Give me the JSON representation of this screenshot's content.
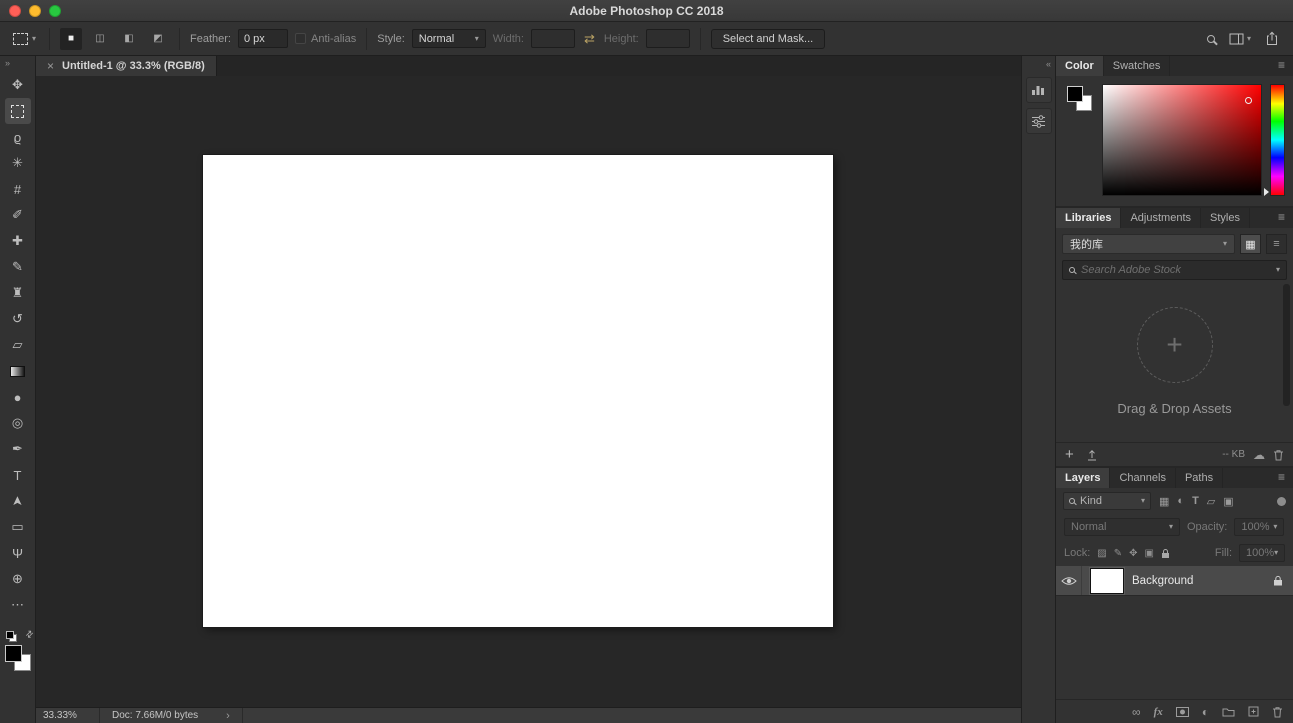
{
  "window": {
    "title": "Adobe Photoshop CC 2018"
  },
  "options_bar": {
    "mode_buttons": [
      {
        "name": "new-selection",
        "glyph": "■"
      },
      {
        "name": "add-to-selection",
        "glyph": "◫"
      },
      {
        "name": "subtract-from-selection",
        "glyph": "◧"
      },
      {
        "name": "intersect-with-selection",
        "glyph": "◩"
      }
    ],
    "feather_label": "Feather:",
    "feather_value": "0 px",
    "antialias_label": "Anti-alias",
    "style_label": "Style:",
    "style_value": "Normal",
    "width_label": "Width:",
    "width_value": "",
    "height_label": "Height:",
    "height_value": "",
    "select_and_mask_label": "Select and Mask..."
  },
  "document_tab": {
    "title": "Untitled-1 @ 33.3% (RGB/8)"
  },
  "toolbar": {
    "selected_tool": "rectangular-marquee-tool",
    "tools": [
      {
        "name": "move-tool",
        "glyph": "✥"
      },
      {
        "name": "rectangular-marquee-tool",
        "glyph": ""
      },
      {
        "name": "lasso-tool",
        "glyph": "ϱ"
      },
      {
        "name": "quick-selection-tool",
        "glyph": "✳"
      },
      {
        "name": "crop-tool",
        "glyph": "#"
      },
      {
        "name": "eyedropper-tool",
        "glyph": "✐"
      },
      {
        "name": "spot-healing-brush-tool",
        "glyph": "✚"
      },
      {
        "name": "brush-tool",
        "glyph": "✎"
      },
      {
        "name": "clone-stamp-tool",
        "glyph": "♜"
      },
      {
        "name": "history-brush-tool",
        "glyph": "↺"
      },
      {
        "name": "eraser-tool",
        "glyph": "▱"
      },
      {
        "name": "gradient-tool",
        "glyph": ""
      },
      {
        "name": "blur-tool",
        "glyph": "●"
      },
      {
        "name": "dodge-tool",
        "glyph": "◎"
      },
      {
        "name": "pen-tool",
        "glyph": "✒"
      },
      {
        "name": "horizontal-type-tool",
        "glyph": "T"
      },
      {
        "name": "path-selection-tool",
        "glyph": "➤"
      },
      {
        "name": "rectangle-tool",
        "glyph": "▭"
      },
      {
        "name": "hand-tool",
        "glyph": "Ψ"
      },
      {
        "name": "zoom-tool",
        "glyph": "⊕"
      },
      {
        "name": "edit-toolbar-button",
        "glyph": "⋯"
      }
    ]
  },
  "statusbar": {
    "zoom": "33.33%",
    "doc_info": "Doc: 7.66M/0 bytes"
  },
  "color_panel": {
    "tabs": [
      "Color",
      "Swatches"
    ],
    "active_tab": "Color"
  },
  "libraries_panel": {
    "tabs": [
      "Libraries",
      "Adjustments",
      "Styles"
    ],
    "active_tab": "Libraries",
    "library_name": "我的库",
    "search_placeholder": "Search Adobe Stock",
    "dropzone_label": "Drag & Drop Assets",
    "size_label": "-- KB"
  },
  "layers_panel": {
    "tabs": [
      "Layers",
      "Channels",
      "Paths"
    ],
    "active_tab": "Layers",
    "filter_label": "Kind",
    "filter_icons": [
      {
        "name": "filter-pixel-layers",
        "glyph": "▦"
      },
      {
        "name": "filter-adjustment-layers",
        "glyph": "◐"
      },
      {
        "name": "filter-type-layers",
        "glyph": "T"
      },
      {
        "name": "filter-shape-layers",
        "glyph": "▱"
      },
      {
        "name": "filter-smart-objects",
        "glyph": "▣"
      }
    ],
    "blend_mode": "Normal",
    "opacity_label": "Opacity:",
    "opacity_value": "100%",
    "lock_label": "Lock:",
    "lock_icons": [
      {
        "name": "lock-transparent-pixels",
        "glyph": "▨"
      },
      {
        "name": "lock-image-pixels",
        "glyph": "✎"
      },
      {
        "name": "lock-position",
        "glyph": "✥"
      },
      {
        "name": "lock-artboards",
        "glyph": "▣"
      }
    ],
    "fill_label": "Fill:",
    "fill_value": "100%",
    "layers": [
      {
        "name": "Background",
        "visible": true,
        "locked": true
      }
    ],
    "fx_icon_label": "fx"
  },
  "icons": {
    "panel_menu": "≡",
    "chevron_down": "▾",
    "chevron_right": "›",
    "collapse_dock": "«",
    "expand_toolbar": "»",
    "swap_dimensions": "⇄",
    "swap_colors": "⇄",
    "grid_view": "▦",
    "list_view": "≡",
    "close_tab": "×",
    "link_layers": "∞",
    "cloud_sync": "☁",
    "adjustment_layer": "◐",
    "plus": "+",
    "dropzone_plus": "+"
  },
  "colors": {
    "foreground": "#000000",
    "background": "#ffffff",
    "traffic_close": "#ff5f57",
    "traffic_minimize": "#febc2e",
    "traffic_zoom": "#28c840"
  }
}
